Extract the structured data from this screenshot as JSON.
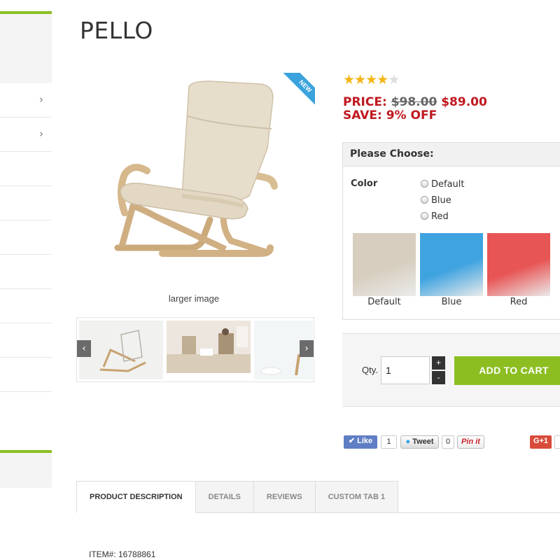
{
  "product": {
    "title": "PELLO",
    "badge": "NEW",
    "larger_image_label": "larger image",
    "rating": {
      "value": 4,
      "max": 5
    },
    "price": {
      "label": "PRICE:",
      "old": "$98.00",
      "new": "$89.00"
    },
    "save": "SAVE: 9% OFF",
    "item_number": "ITEM#: 16788861"
  },
  "options": {
    "heading": "Please Choose:",
    "attribute_label": "Color",
    "radios": [
      "Default",
      "Blue",
      "Red"
    ],
    "swatches": [
      {
        "label": "Default",
        "color": "#d7cebf"
      },
      {
        "label": "Blue",
        "color": "#3fa3e0"
      },
      {
        "label": "Red",
        "color": "#e85555"
      }
    ]
  },
  "cart": {
    "qty_label": "Qty.",
    "qty_value": "1",
    "plus": "+",
    "minus": "-",
    "add_button": "ADD TO CART"
  },
  "thumbnails": {
    "prev": "‹",
    "next": "›"
  },
  "social": {
    "like": "Like",
    "like_count": "1",
    "tweet": "Tweet",
    "tweet_count": "0",
    "pin": "Pin it",
    "gplus": "G+1"
  },
  "sidebar": {
    "chevron": "›"
  },
  "tabs": [
    "PRODUCT DESCRIPTION",
    "DETAILS",
    "REVIEWS",
    "CUSTOM TAB 1"
  ],
  "colors": {
    "accent": "#8cbe22",
    "price": "#c0181f",
    "ribbon": "#3aa3dd"
  }
}
